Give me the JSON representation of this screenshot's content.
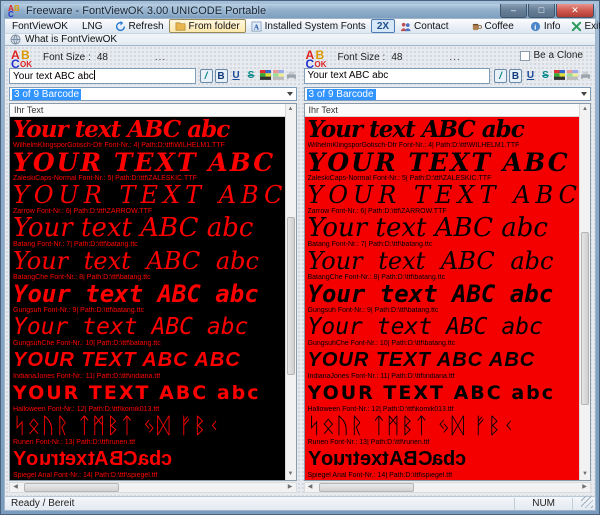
{
  "window": {
    "title": "Freeware - FontViewOK 3.00 UNICODE Portable"
  },
  "menubar": {
    "menus": [
      {
        "label": "FontViewOK"
      },
      {
        "label": "LNG"
      }
    ]
  },
  "toolbar": {
    "refresh": "Refresh",
    "from_folder": "From folder",
    "installed_fonts": "Installed System Fonts",
    "zoom_2x": "2X",
    "contact": "Contact",
    "coffee": "Coffee",
    "info": "Info",
    "exit": "Exit"
  },
  "help_row": {
    "label": "What is FontViewOK"
  },
  "pane_shared": {
    "font_size_label": "Font Size :",
    "font_size_value": "48",
    "more_button": "...",
    "sample_text": "Your text ABC abc",
    "dropdown_value": "3 of 9 Barcode",
    "list_header": "Ihr Text",
    "format": {
      "italic": "/",
      "bold": "B",
      "underline": "U",
      "strike": "S"
    }
  },
  "right_pane": {
    "clone_checkbox_label": "Be a Clone"
  },
  "colors": {
    "left_list_bg": "#000000",
    "left_list_text": "#ff0000",
    "right_list_bg": "#f40000",
    "right_list_text": "#000000",
    "selection": "#3194ff",
    "close_button": "#cf5a50"
  },
  "fonts": [
    {
      "preview": "Your text ABC abc",
      "style": "blackletter",
      "caption": "WilhelmKlingsporGotisch-Dfr Font-Nr.: 4| Path:D:\\ttf\\WILHELM1.TTF"
    },
    {
      "preview": "YOUR TEXT ABC A",
      "style": "heavycaps",
      "caption": "ZaleskiCaps-Normal Font-Nr.: 5| Path:D:\\ttf\\ZALESKIC.TTF"
    },
    {
      "preview": "YOUR TEXT ABC A",
      "style": "thincaps",
      "caption": "Zarrow Font-Nr.: 6| Path:D:\\ttf\\ZARROW.TTF"
    },
    {
      "preview": "Your text ABC abc",
      "style": "serifitalic",
      "caption": "Batang Font-Nr.: 7| Path:D:\\ttf\\batang.ttc"
    },
    {
      "preview": "Your text ABC abc",
      "style": "serifitalicwide",
      "caption": "BatangChe Font-Nr.: 8| Path:D:\\ttf\\batang.ttc"
    },
    {
      "preview": "Your text ABC abc",
      "style": "monobolditalic",
      "caption": "Gungsuh Font-Nr.: 9| Path:D:\\ttf\\batang.ttc"
    },
    {
      "preview": "Your text ABC abc",
      "style": "monoitalic",
      "caption": "GungsuhChe Font-Nr.: 10| Path:D:\\ttf\\batang.ttc"
    },
    {
      "preview": "YOUR TEXT ABC ABC",
      "style": "brush",
      "caption": "IndianaJones Font-Nr.: 11| Path:D:\\ttf\\indiana.ttf"
    },
    {
      "preview": "YOUR TEXT ABC abc",
      "style": "comic",
      "caption": "Halloween Font-Nr.: 12| Path:D:\\ttf\\komik013.ttf"
    },
    {
      "preview": "ᛋᛟᚢᚱ ᛏᛗᛒᛏ ᛃᛞ ᚠᛒᚲ",
      "style": "runes",
      "caption": "Runen Font-Nr.: 13| Path:D:\\ttf\\runen.ttf"
    },
    {
      "preview": "Your text ABC abc",
      "style": "mirror",
      "caption": "Spiegel Arial Font-Nr.: 14| Path:D:\\ttf\\spiegel.ttf"
    }
  ],
  "statusbar": {
    "ready": "Ready / Bereit",
    "num": "NUM"
  }
}
